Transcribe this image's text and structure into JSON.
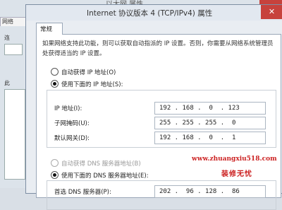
{
  "background_window": {
    "title": "以太网 属性",
    "tab_label": "网络",
    "side_label_1": "连",
    "side_label_2": "此"
  },
  "dialog": {
    "title": "Internet 协议版本 4 (TCP/IPv4) 属性",
    "close_glyph": "✕",
    "tab": "常规",
    "description": "如果网络支持此功能，则可以获取自动指派的 IP 设置。否则，你需要从网络系统管理员处获得适当的 IP 设置。"
  },
  "ip_section": {
    "auto_label": "自动获得 IP 地址(O)",
    "manual_label": "使用下面的 IP 地址(S):",
    "selected": "manual",
    "fields": [
      {
        "label": "IP 地址(I):",
        "value": "192 . 168 .  0  . 123"
      },
      {
        "label": "子网掩码(U):",
        "value": "255 . 255 . 255 .  0"
      },
      {
        "label": "默认网关(D):",
        "value": "192 . 168 .  0  .  1"
      }
    ]
  },
  "dns_section": {
    "auto_label": "自动获得 DNS 服务器地址(B)",
    "manual_label": "使用下面的 DNS 服务器地址(E):",
    "selected": "manual",
    "fields": [
      {
        "label": "首选 DNS 服务器(P):",
        "value": "202 .  96 . 128 .  86"
      }
    ]
  },
  "watermark": {
    "url": "www.zhuangxiu518.com",
    "name": "装修无忧"
  },
  "colors": {
    "close_button": "#c7423c",
    "watermark": "#cc2222"
  }
}
